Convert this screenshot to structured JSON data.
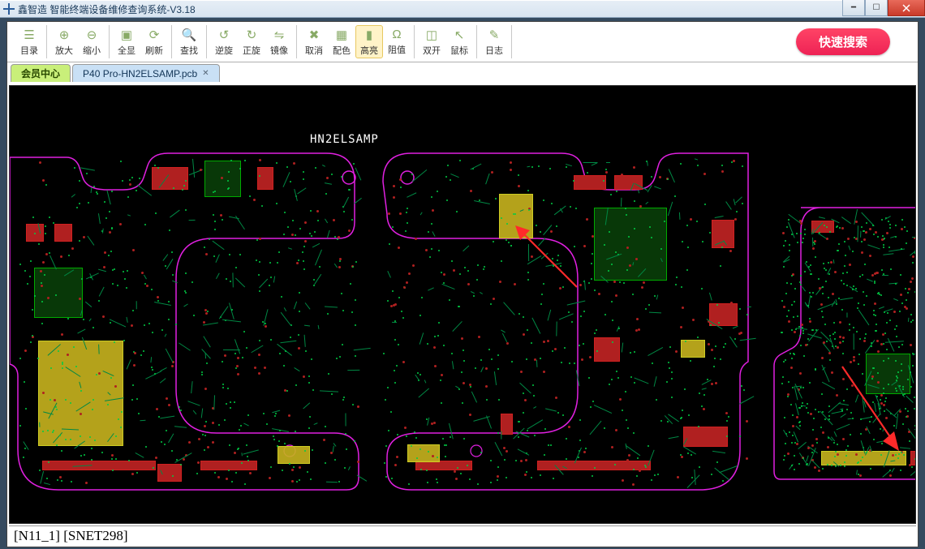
{
  "app": {
    "title": "鑫智造 智能终端设备维修查询系统-V3.18"
  },
  "toolbar": {
    "items": [
      {
        "label": "目录",
        "icon": "☰"
      },
      {
        "label": "放大",
        "icon": "⊕"
      },
      {
        "label": "缩小",
        "icon": "⊖"
      },
      {
        "label": "全显",
        "icon": "▣"
      },
      {
        "label": "刷新",
        "icon": "⟳"
      },
      {
        "label": "查找",
        "icon": "🔍"
      },
      {
        "label": "逆旋",
        "icon": "↺"
      },
      {
        "label": "正旋",
        "icon": "↻"
      },
      {
        "label": "镜像",
        "icon": "⇋"
      },
      {
        "label": "取消",
        "icon": "✖"
      },
      {
        "label": "配色",
        "icon": "▦"
      },
      {
        "label": "高亮",
        "icon": "▮",
        "active": true
      },
      {
        "label": "阻值",
        "icon": "Ω"
      },
      {
        "label": "双开",
        "icon": "◫"
      },
      {
        "label": "鼠标",
        "icon": "↖"
      },
      {
        "label": "日志",
        "icon": "✎"
      }
    ],
    "groups": [
      [
        0
      ],
      [
        1,
        2
      ],
      [
        3,
        4
      ],
      [
        5
      ],
      [
        6,
        7,
        8
      ],
      [
        9,
        10,
        11,
        12
      ],
      [
        13,
        14
      ],
      [
        15
      ]
    ],
    "quick_search": "快速搜索"
  },
  "tabs": {
    "member": "会员中心",
    "file": "P40 Pro-HN2ELSAMP.pcb"
  },
  "canvas": {
    "board_label": "HN2ELSAMP"
  },
  "status": {
    "net": "[N11_1] [SNET298]"
  }
}
